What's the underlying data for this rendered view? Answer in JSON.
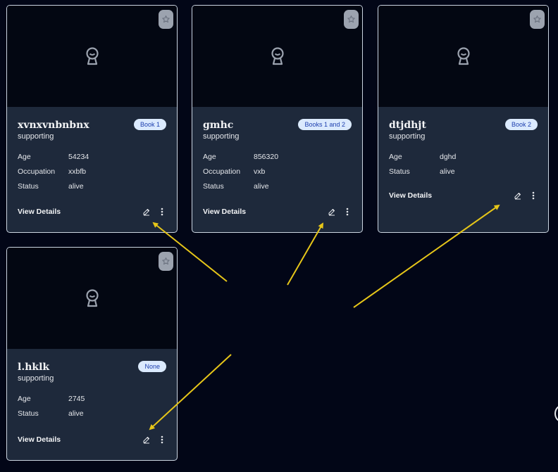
{
  "cards": [
    {
      "name": "xvnxvnbnbnx",
      "role": "supporting",
      "badge": "Book 1",
      "fields": [
        {
          "label": "Age",
          "value": "54234"
        },
        {
          "label": "Occupation",
          "value": "xxbfb"
        },
        {
          "label": "Status",
          "value": "alive"
        }
      ],
      "view_details": "View Details"
    },
    {
      "name": "gmhc",
      "role": "supporting",
      "badge": "Books 1 and 2",
      "fields": [
        {
          "label": "Age",
          "value": "856320"
        },
        {
          "label": "Occupation",
          "value": "vxb"
        },
        {
          "label": "Status",
          "value": "alive"
        }
      ],
      "view_details": "View Details"
    },
    {
      "name": "dtjdhjt",
      "role": "supporting",
      "badge": "Book 2",
      "fields": [
        {
          "label": "Age",
          "value": "dghd"
        },
        {
          "label": "Status",
          "value": "alive"
        }
      ],
      "view_details": "View Details"
    },
    {
      "name": "l.hklk",
      "role": "supporting",
      "badge": "None",
      "fields": [
        {
          "label": "Age",
          "value": "2745"
        },
        {
          "label": "Status",
          "value": "alive"
        }
      ],
      "view_details": "View Details"
    }
  ],
  "colors": {
    "background": "#020617",
    "card_body": "#1e293b",
    "image_area": "#030712",
    "badge_bg": "#dbeafe",
    "badge_text": "#1e40af",
    "annotation_arrow": "#e6c619"
  },
  "icons": {
    "favorite": "star-icon",
    "placeholder": "character-placeholder-icon",
    "edit": "pencil-icon",
    "more": "kebab-menu-icon"
  }
}
